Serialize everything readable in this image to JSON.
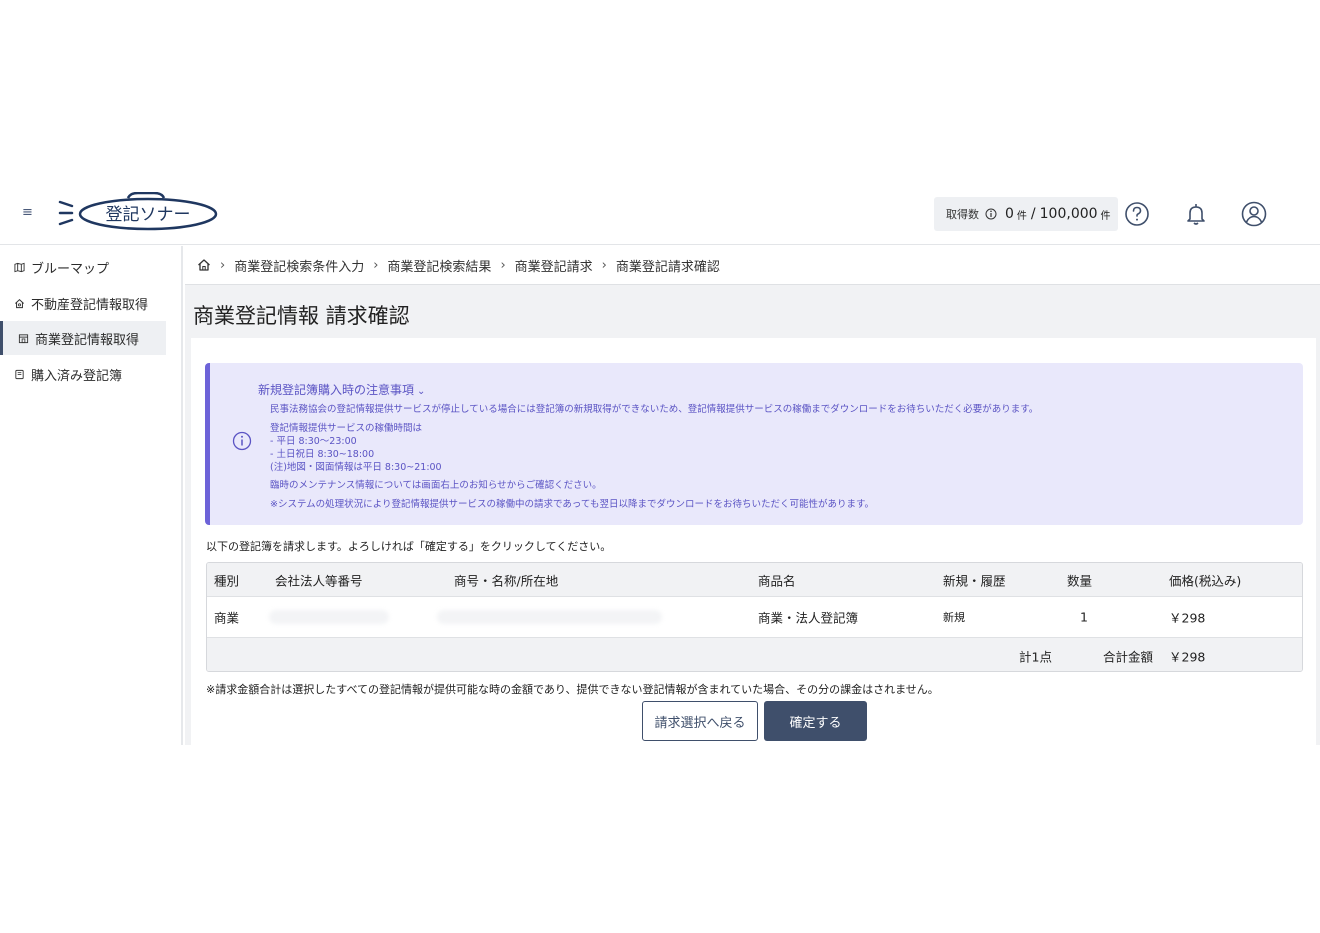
{
  "header": {
    "logo_text": "登記ソナー",
    "quota": {
      "label": "取得数",
      "count": "0",
      "unit": "件",
      "separator": "/",
      "limit": "100,000",
      "limit_unit": "件"
    },
    "icons": [
      "menu-icon",
      "help-icon",
      "bell-icon",
      "user-icon"
    ]
  },
  "sidebar": {
    "items": [
      {
        "label": "ブルーマップ",
        "icon": "map-icon"
      },
      {
        "label": "不動産登記情報取得",
        "icon": "house-icon"
      },
      {
        "label": "商業登記情報取得",
        "icon": "store-icon",
        "active": true
      },
      {
        "label": "購入済み登記簿",
        "icon": "book-icon"
      }
    ]
  },
  "breadcrumb": [
    "商業登記検索条件入力",
    "商業登記検索結果",
    "商業登記請求",
    "商業登記請求確認"
  ],
  "page": {
    "title": "商業登記情報 請求確認"
  },
  "notice": {
    "title": "新規登記簿購入時の注意事項",
    "lines": [
      "民事法務協会の登記情報提供サービスが停止している場合には登記簿の新規取得ができないため、登記情報提供サービスの稼働までダウンロードをお待ちいただく必要があります。",
      "登記情報提供サービスの稼働時間は",
      "- 平日 8:30〜23:00",
      "- 土日祝日 8:30~18:00",
      "(注)地図・図面情報は平日 8:30~21:00",
      "臨時のメンテナンス情報については画面右上のお知らせからご確認ください。",
      "※システムの処理状況により登記情報提供サービスの稼働中の請求であっても翌日以降までダウンロードをお待ちいただく可能性があります。"
    ]
  },
  "instruction": "以下の登記簿を請求します。よろしければ「確定する」をクリックしてください。",
  "table": {
    "headers": [
      "種別",
      "会社法人等番号",
      "商号・名称/所在地",
      "商品名",
      "新規・履歴",
      "数量",
      "価格(税込み)"
    ],
    "rows": [
      {
        "type": "商業",
        "corp_number": "",
        "name_address": "",
        "product": "商業・法人登記簿",
        "new_history": "新規",
        "quantity": "1",
        "price": "￥298"
      }
    ],
    "footer": {
      "count": "計1点",
      "total_label": "合計金額",
      "total": "￥298"
    }
  },
  "note": "※請求金額合計は選択したすべての登記情報が提供可能な時の金額であり、提供できない登記情報が含まれていた場合、その分の課金はされません。",
  "buttons": {
    "back": "請求選択へ戻る",
    "confirm": "確定する"
  }
}
